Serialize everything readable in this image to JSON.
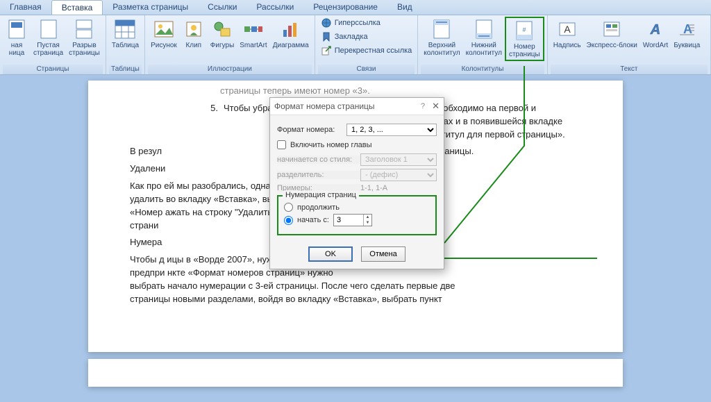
{
  "tabs": [
    "Главная",
    "Вставка",
    "Разметка страницы",
    "Ссылки",
    "Рассылки",
    "Рецензирование",
    "Вид"
  ],
  "active_tab": 1,
  "ribbon": {
    "pages": {
      "label": "Страницы",
      "items": [
        "ная\nница",
        "Пустая\nстраница",
        "Разрыв\nстраницы"
      ]
    },
    "tables": {
      "label": "Таблицы",
      "items": [
        "Таблица"
      ]
    },
    "illus": {
      "label": "Иллюстрации",
      "items": [
        "Рисунок",
        "Клип",
        "Фигуры",
        "SmartArt",
        "Диаграмма"
      ]
    },
    "links": {
      "label": "Связи",
      "items": [
        "Гиперссылка",
        "Закладка",
        "Перекрестная ссылка"
      ]
    },
    "hf": {
      "label": "Колонтитулы",
      "items": [
        "Верхний\nколонтитул",
        "Нижний\nколонтитул",
        "Номер\nстраницы"
      ]
    },
    "text": {
      "label": "Текст",
      "items": [
        "Надпись",
        "Экспресс-блоки",
        "WordArt",
        "Буквица"
      ]
    }
  },
  "doc": {
    "cut_top": "страницы теперь имеют номер «3».",
    "li5_num": "5.",
    "li5": "Чтобы убрать номера на первых двух страницах, необходимо на первой и",
    "p1a": "й номерах и в появившейся вкладке",
    "p1b": "й колонтитул для первой страницы».",
    "p2": "В резул                                                              ция теперь начинается с 3 страницы.",
    "p3": "Удалени",
    "p4": "Как про                                                              ей мы разобрались, однако, как можно\nудалить                                                               во вкладку «Вставка», выбрать пункт\n«Номер                                                               ажать на строку \"Удалить номера\nстрани",
    "p5": "Нумера",
    "p6": "Чтобы д                                                              ицы в «Ворде 2007», нужно\nпредпри                                                              нкте «Формат номеров страниц» нужно\nвыбрать начало нумерации с 3-ей страницы. После чего сделать первые две\nстраницы новыми разделами, войдя во вкладку «Вставка», выбрать пункт"
  },
  "dialog": {
    "title": "Формат номера страницы",
    "format_label": "Формат номера:",
    "format_value": "1, 2, 3, ...",
    "include_chapter": "Включить номер главы",
    "starts_style_label": "начинается со стиля:",
    "starts_style_value": "Заголовок 1",
    "separator_label": "разделитель:",
    "separator_value": "-   (дефис)",
    "examples_label": "Примеры:",
    "examples_value": "1-1, 1-A",
    "numbering_legend": "Нумерация страниц",
    "continue": "продолжить",
    "start_at": "начать с:",
    "start_value": "3",
    "ok": "OK",
    "cancel": "Отмена"
  }
}
